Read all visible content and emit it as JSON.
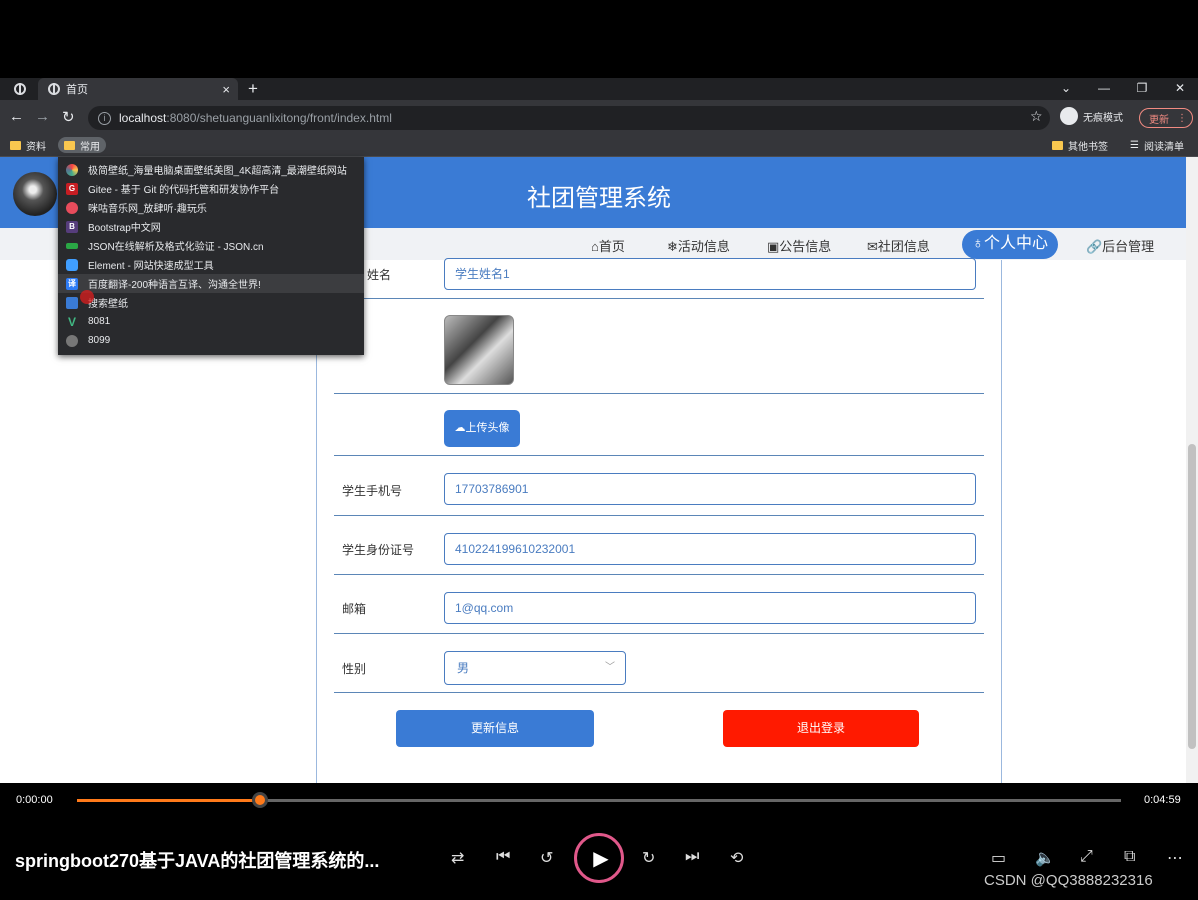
{
  "browser": {
    "tab_title": "首页",
    "tab_close": "×",
    "new_tab": "+",
    "window_controls": [
      "⌄",
      "—",
      "❐",
      "✕"
    ],
    "url_host": "localhost",
    "url_rest": ":8080/shetuanguanlixitong/front/index.html",
    "incognito_label": "无痕模式",
    "update_label": "更新",
    "bookmarks": {
      "left": [
        "资料",
        "常用"
      ],
      "right": [
        "其他书签",
        "阅读清单"
      ]
    }
  },
  "dropdown_items": [
    {
      "label": "极简壁纸_海量电脑桌面壁纸美图_4K超高清_最潮壁纸网站",
      "icon": "colorful-circle",
      "color": "#f4a261"
    },
    {
      "label": "Gitee - 基于 Git 的代码托管和研发协作平台",
      "icon": "G",
      "color": "#c71d23"
    },
    {
      "label": "咪咕音乐网_放肆听·趣玩乐",
      "icon": "migu",
      "color": "#e84c5c"
    },
    {
      "label": "Bootstrap中文网",
      "icon": "B",
      "color": "#563d7c"
    },
    {
      "label": "JSON在线解析及格式化验证 - JSON.cn",
      "icon": "json",
      "color": "#2aa745"
    },
    {
      "label": "Element - 网站快速成型工具",
      "icon": "element",
      "color": "#409eff"
    },
    {
      "label": "百度翻译-200种语言互译、沟通全世界!",
      "icon": "译",
      "color": "#2e7cf6"
    },
    {
      "label": "搜索壁纸",
      "icon": "wallpaper",
      "color": "#3a7bd5"
    },
    {
      "label": "8081",
      "icon": "vue",
      "color": "#41b883"
    },
    {
      "label": "8099",
      "icon": "globe",
      "color": "#777777"
    }
  ],
  "site": {
    "title": "社团管理系统",
    "nav": [
      "⌂首页",
      "❄活动信息",
      "▣公告信息",
      "✉社团信息",
      "♁个人中心",
      "🔗后台管理"
    ],
    "nav_active_index": 4
  },
  "form": {
    "name_label": "学生姓名",
    "name_label_visible": "姓名",
    "name_value": "学生姓名1",
    "upload_label": "上传头像",
    "phone_label": "学生手机号",
    "phone_value": "17703786901",
    "id_label": "学生身份证号",
    "id_value": "410224199610232001",
    "email_label": "邮箱",
    "email_value": "1@qq.com",
    "gender_label": "性别",
    "gender_value": "男",
    "update_button": "更新信息",
    "logout_button": "退出登录"
  },
  "player": {
    "current_time": "0:00:00",
    "total_time": "0:04:59",
    "progress": 0.175,
    "title": "springboot270基于JAVA的社团管理系统的...",
    "watermark": "CSDN @QQ3888232316",
    "accent": "#ff7a1a"
  }
}
